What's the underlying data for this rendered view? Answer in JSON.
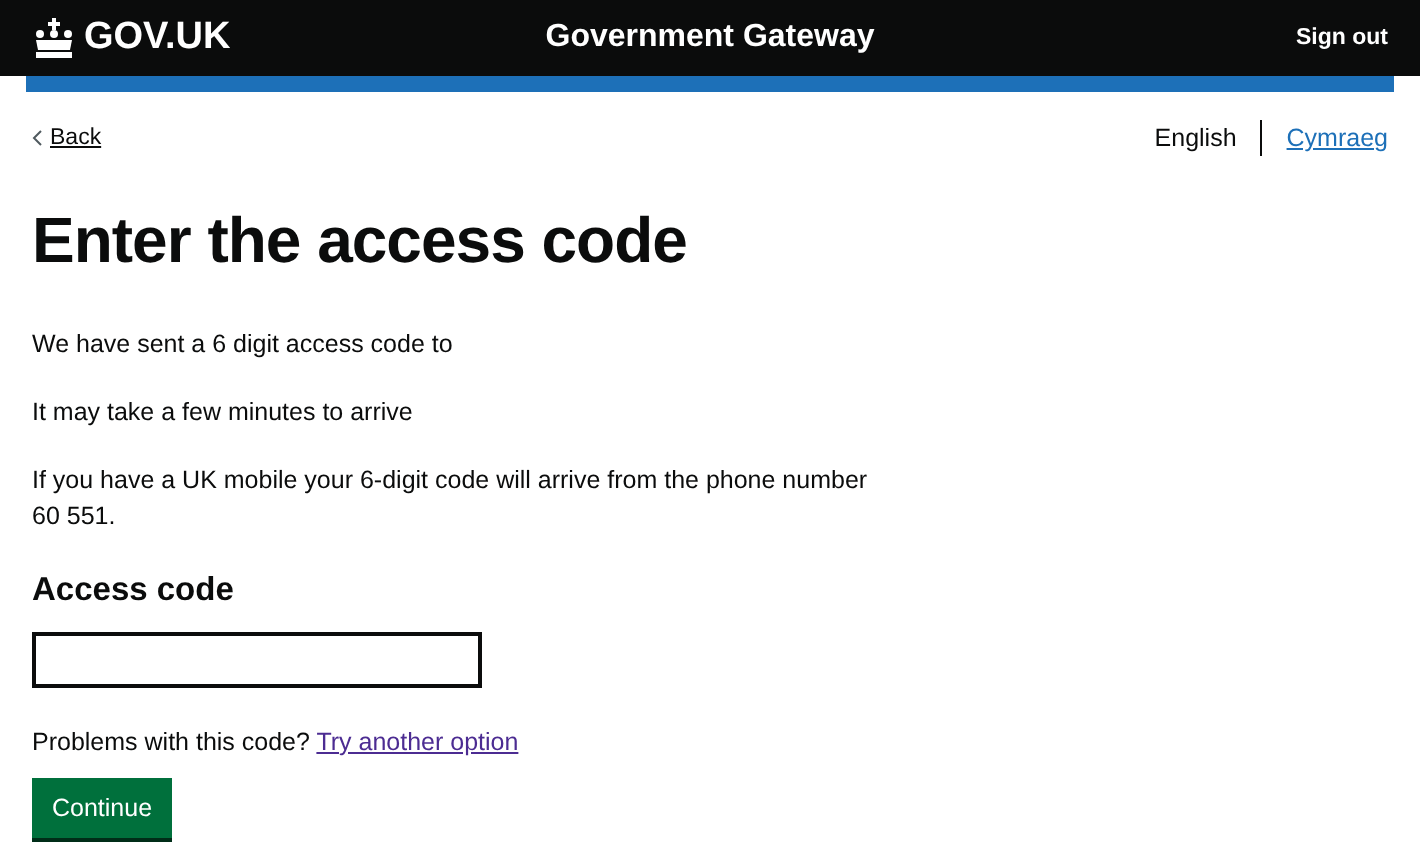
{
  "header": {
    "logo": "GOV.UK",
    "service": "Government Gateway",
    "sign_out": "Sign out"
  },
  "back": "Back",
  "languages": [
    {
      "label": "English",
      "selected": true
    },
    {
      "label": "Cymraeg",
      "selected": false
    }
  ],
  "heading": "Enter the access code",
  "paragraphs": [
    "We have sent a 6 digit access code to",
    "It may take a few minutes to arrive",
    "If you have a UK mobile your 6-digit code will arrive from the phone number 60 551."
  ],
  "field": {
    "label": "Access code"
  },
  "help": {
    "text": "Problems with this code?",
    "link": "Try another option"
  },
  "button": "Continue"
}
